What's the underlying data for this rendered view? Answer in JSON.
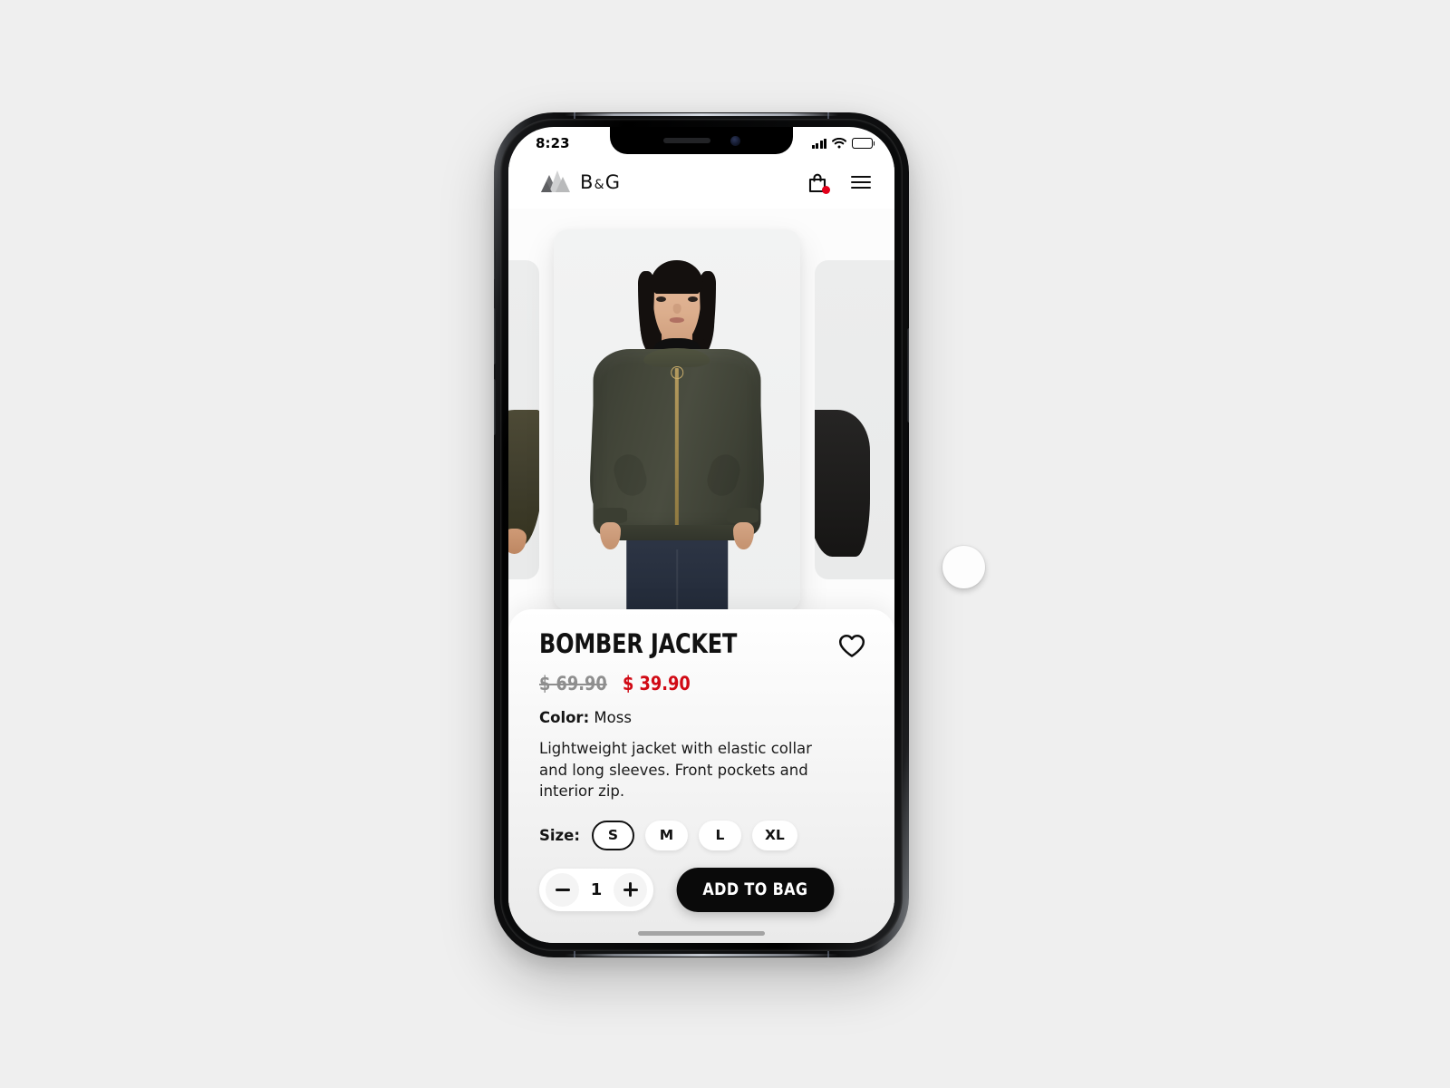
{
  "status_bar": {
    "time": "8:23",
    "signal_icon": "cellular-signal-icon",
    "wifi_icon": "wifi-icon",
    "battery_icon": "battery-full-icon"
  },
  "header": {
    "logo_icon": "mountains-logo-icon",
    "brand_first": "B",
    "brand_amp": "&",
    "brand_last": "G",
    "cart_icon": "shopping-bag-icon",
    "cart_has_badge": true,
    "menu_icon": "hamburger-menu-icon"
  },
  "gallery": {
    "slides": [
      {
        "alt": "previous-product-image"
      },
      {
        "alt": "bomber-jacket-front-view"
      },
      {
        "alt": "next-product-image"
      }
    ],
    "active_index": 1
  },
  "product": {
    "title": "BOMBER JACKET",
    "price_old": "$ 69.90",
    "price_new": "$ 39.90",
    "color_label": "Color:",
    "color_value": "Moss",
    "description": "Lightweight jacket with elastic collar and long sleeves. Front pockets and interior zip.",
    "favorite_icon": "heart-outline-icon",
    "is_favorite": false
  },
  "size_selector": {
    "label": "Size:",
    "options": [
      {
        "label": "S",
        "selected": true
      },
      {
        "label": "M",
        "selected": false
      },
      {
        "label": "L",
        "selected": false
      },
      {
        "label": "XL",
        "selected": false
      }
    ]
  },
  "quantity": {
    "decrease_icon": "minus-icon",
    "value": "1",
    "increase_icon": "plus-icon"
  },
  "cta": {
    "add_to_bag_label": "ADD TO BAG"
  },
  "colors": {
    "accent_red": "#d10a15",
    "badge_red": "#e2001a",
    "price_old_gray": "#8e8e8e",
    "cta_black": "#0a0a0a",
    "page_background": "#efefef",
    "jacket_moss": "#434639"
  },
  "cursor": {
    "label": "pointer-indicator"
  }
}
